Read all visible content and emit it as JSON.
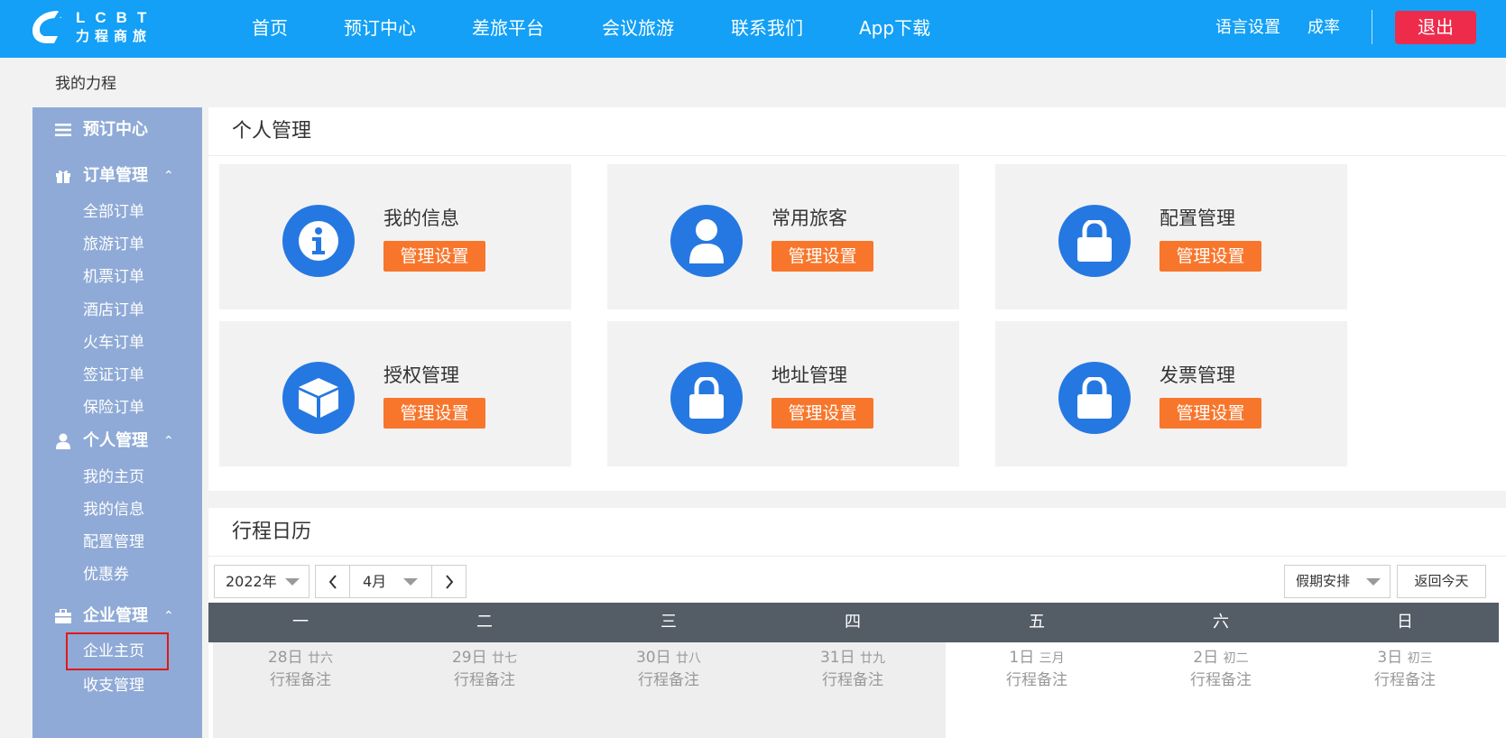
{
  "logo": {
    "en": "LCBT",
    "cn": "力程商旅"
  },
  "nav": {
    "items": [
      "首页",
      "预订中心",
      "差旅平台",
      "会议旅游",
      "联系我们",
      "App下载"
    ],
    "language": "语言设置",
    "user": "成率",
    "logout": "退出"
  },
  "breadcrumb": "我的力程",
  "sidebar": {
    "booking": {
      "label": "预订中心",
      "icon": "menu-icon"
    },
    "orders": {
      "label": "订单管理",
      "icon": "gift-icon",
      "items": [
        "全部订单",
        "旅游订单",
        "机票订单",
        "酒店订单",
        "火车订单",
        "签证订单",
        "保险订单"
      ]
    },
    "personal": {
      "label": "个人管理",
      "icon": "user-icon",
      "items": [
        "我的主页",
        "我的信息",
        "配置管理",
        "优惠券"
      ]
    },
    "enterprise": {
      "label": "企业管理",
      "icon": "briefcase-icon",
      "items": [
        "企业主页",
        "收支管理"
      ]
    }
  },
  "personal_panel": {
    "title": "个人管理",
    "cards": [
      {
        "title": "我的信息",
        "button": "管理设置",
        "icon": "info-icon"
      },
      {
        "title": "常用旅客",
        "button": "管理设置",
        "icon": "user-icon"
      },
      {
        "title": "配置管理",
        "button": "管理设置",
        "icon": "lock-icon"
      },
      {
        "title": "授权管理",
        "button": "管理设置",
        "icon": "box-icon"
      },
      {
        "title": "地址管理",
        "button": "管理设置",
        "icon": "lock-icon"
      },
      {
        "title": "发票管理",
        "button": "管理设置",
        "icon": "lock-icon"
      }
    ]
  },
  "calendar": {
    "title": "行程日历",
    "year": "2022年",
    "month": "4月",
    "holiday": "假期安排",
    "today": "返回今天",
    "weekdays": [
      "一",
      "二",
      "三",
      "四",
      "五",
      "六",
      "日"
    ],
    "days": [
      {
        "num": "28日",
        "lunar": "廿六",
        "note": "行程备注"
      },
      {
        "num": "29日",
        "lunar": "廿七",
        "note": "行程备注"
      },
      {
        "num": "30日",
        "lunar": "廿八",
        "note": "行程备注"
      },
      {
        "num": "31日",
        "lunar": "廿九",
        "note": "行程备注"
      },
      {
        "num": "1日",
        "lunar": "三月",
        "note": "行程备注"
      },
      {
        "num": "2日",
        "lunar": "初二",
        "note": "行程备注"
      },
      {
        "num": "3日",
        "lunar": "初三",
        "note": "行程备注"
      }
    ]
  }
}
